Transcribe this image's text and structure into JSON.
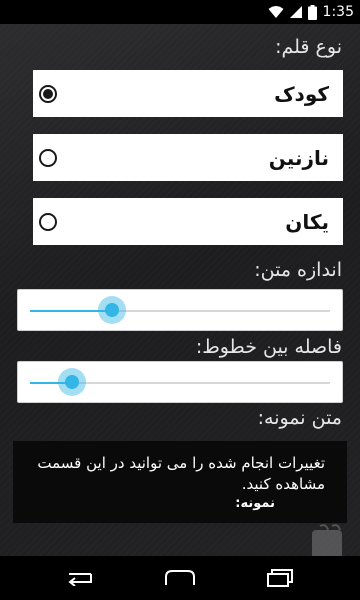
{
  "status_bar": {
    "time": "1:35"
  },
  "font_type": {
    "label": "نوع قلم:",
    "options": [
      {
        "label": "کودک",
        "selected": true
      },
      {
        "label": "نازنین",
        "selected": false
      },
      {
        "label": "یکان",
        "selected": false
      }
    ]
  },
  "font_size": {
    "label": "اندازه متن:",
    "value_fraction": 0.27
  },
  "line_spacing": {
    "label": "فاصله بین خطوط:",
    "value_fraction": 0.14
  },
  "sample": {
    "label": "متن نمونه:",
    "text": "تغییرات انجام شده را می توانید در این قسمت مشاهده کنید.",
    "sample_word": "نمونه:"
  },
  "accent_color": "#33b5e5"
}
